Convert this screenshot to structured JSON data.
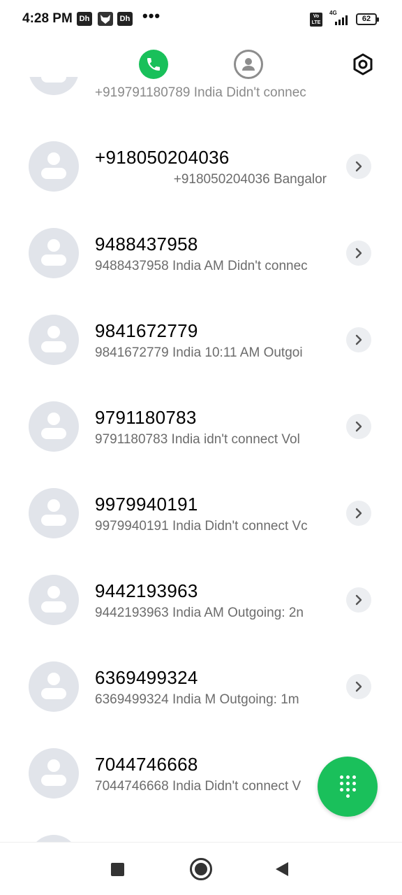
{
  "status_bar": {
    "time": "4:28 PM",
    "notification_icons": [
      "Dh",
      "fox",
      "Dh"
    ],
    "more": "•••",
    "volte_label": "Vo LTE",
    "network_label": "4G",
    "battery_level": "62"
  },
  "top_tabs": {
    "icons": [
      "phone-icon",
      "contact-icon",
      "settings-icon"
    ],
    "active": "phone",
    "accent_color": "#19c05a"
  },
  "calls": [
    {
      "name": "",
      "subtitle": "+919791180789 India Didn't connec"
    },
    {
      "name": "+918050204036",
      "subtitle": "+918050204036 Bangalor"
    },
    {
      "name": "9488437958",
      "subtitle": "9488437958 India  AM Didn't connec"
    },
    {
      "name": "9841672779",
      "subtitle": "9841672779 India  10:11 AM Outgoi"
    },
    {
      "name": "9791180783",
      "subtitle": "9791180783 India  idn't connect Vol"
    },
    {
      "name": "9979940191",
      "subtitle": "9979940191 India  Didn't connect Vc"
    },
    {
      "name": "9442193963",
      "subtitle": "9442193963 India  AM Outgoing: 2n"
    },
    {
      "name": "6369499324",
      "subtitle": "6369499324 India  M Outgoing: 1m"
    },
    {
      "name": "7044746668",
      "subtitle": "7044746668 India  Didn't connect V"
    }
  ],
  "fab": {
    "icon": "dialpad-icon"
  },
  "nav_bar": {
    "icons": [
      "recents-icon",
      "home-icon",
      "back-icon"
    ]
  }
}
